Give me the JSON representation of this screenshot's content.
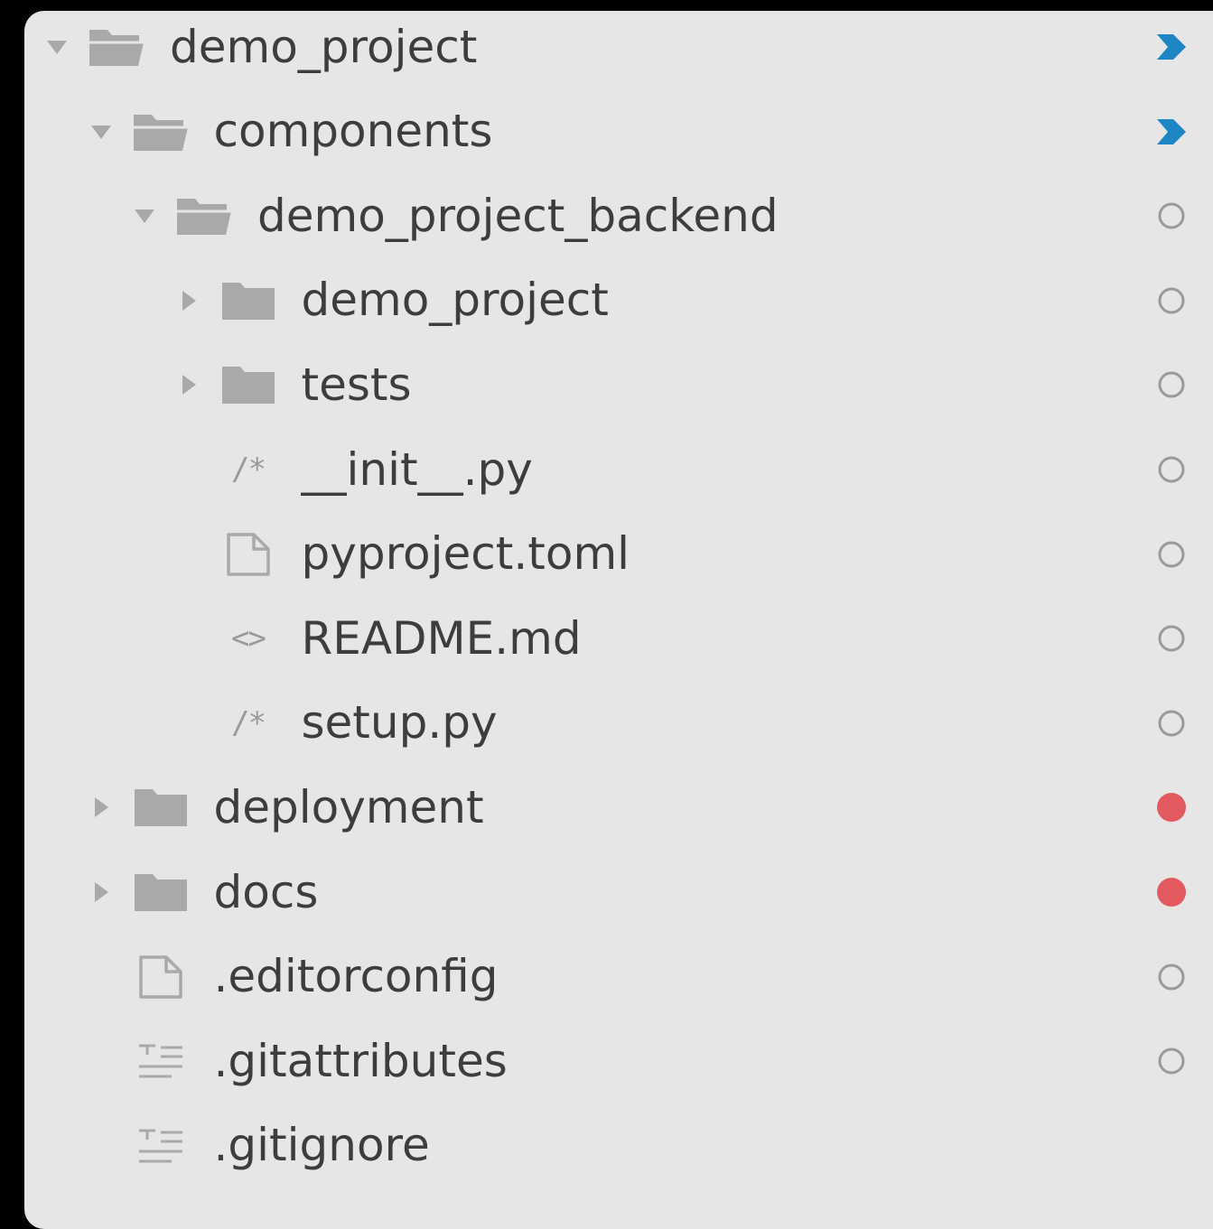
{
  "colors": {
    "panel_background": "#e6e6e6",
    "text": "#3d3d3d",
    "icon_gray": "#a9a9a9",
    "status_blue": "#1f86c6",
    "status_red": "#e25a5f",
    "status_ring": "#9a9a9a"
  },
  "tree": [
    {
      "label": "demo_project",
      "depth": 0,
      "twisty": "expanded",
      "icon": "folder-open-icon",
      "status": "blue-chevron"
    },
    {
      "label": "components",
      "depth": 1,
      "twisty": "expanded",
      "icon": "folder-open-icon",
      "status": "blue-chevron"
    },
    {
      "label": "demo_project_backend",
      "depth": 2,
      "twisty": "expanded",
      "icon": "folder-open-icon",
      "status": "ring"
    },
    {
      "label": "demo_project",
      "depth": 3,
      "twisty": "collapsed",
      "icon": "folder-icon",
      "status": "ring"
    },
    {
      "label": "tests",
      "depth": 3,
      "twisty": "collapsed",
      "icon": "folder-icon",
      "status": "ring"
    },
    {
      "label": "__init__.py",
      "depth": 3,
      "twisty": "none",
      "icon": "code-comment-icon",
      "glyph": "/*",
      "status": "ring"
    },
    {
      "label": "pyproject.toml",
      "depth": 3,
      "twisty": "none",
      "icon": "file-icon",
      "status": "ring"
    },
    {
      "label": "README.md",
      "depth": 3,
      "twisty": "none",
      "icon": "markup-icon",
      "glyph": "<>",
      "status": "ring"
    },
    {
      "label": "setup.py",
      "depth": 3,
      "twisty": "none",
      "icon": "code-comment-icon",
      "glyph": "/*",
      "status": "ring"
    },
    {
      "label": "deployment",
      "depth": 1,
      "twisty": "collapsed",
      "icon": "folder-icon",
      "status": "red-dot"
    },
    {
      "label": "docs",
      "depth": 1,
      "twisty": "collapsed",
      "icon": "folder-icon",
      "status": "red-dot"
    },
    {
      "label": ".editorconfig",
      "depth": 1,
      "twisty": "none",
      "icon": "file-icon",
      "status": "ring"
    },
    {
      "label": ".gitattributes",
      "depth": 1,
      "twisty": "none",
      "icon": "text-lines-icon",
      "status": "ring"
    },
    {
      "label": ".gitignore",
      "depth": 1,
      "twisty": "none",
      "icon": "text-lines-icon",
      "status": "none"
    }
  ]
}
